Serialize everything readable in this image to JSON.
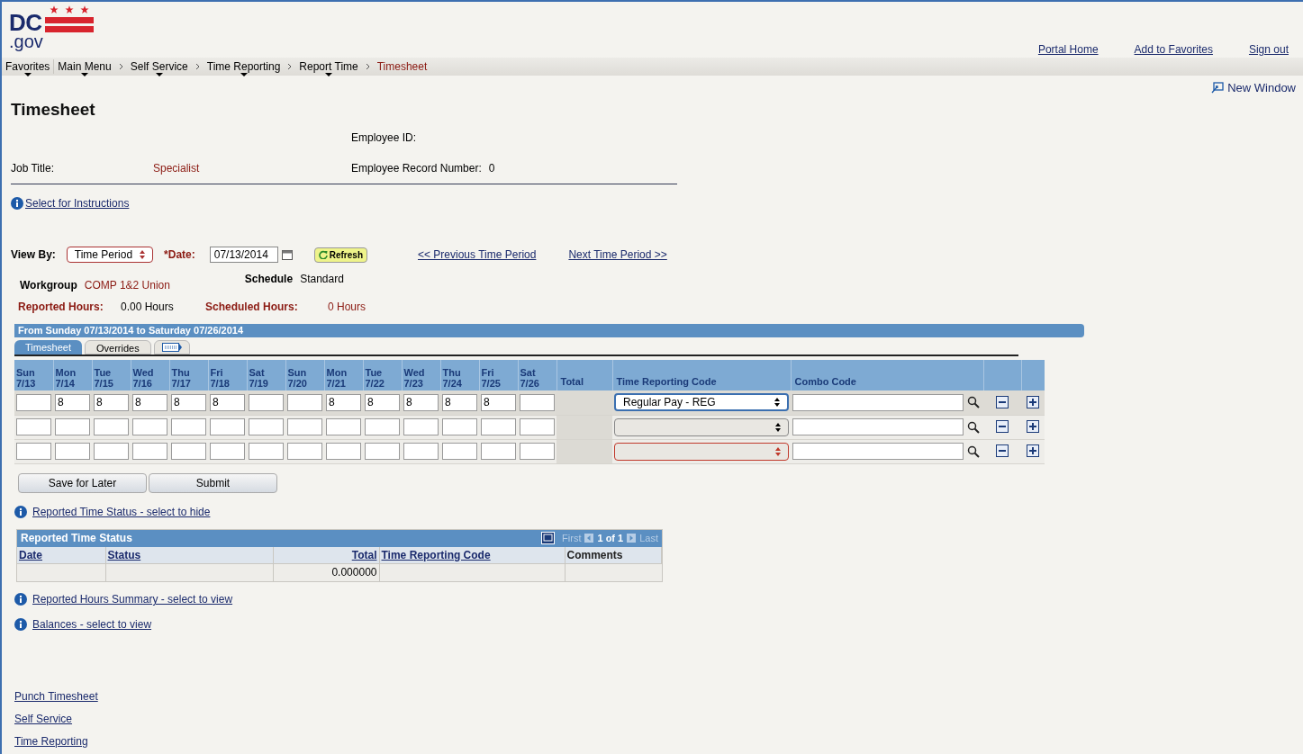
{
  "logo": {
    "name": "DC",
    "domain": ".gov"
  },
  "header_links": [
    "Portal Home",
    "Add to Favorites",
    "Sign out"
  ],
  "breadcrumb": [
    {
      "label": "Favorites",
      "dropdown": true,
      "current": false
    },
    {
      "label": "Main Menu",
      "dropdown": true,
      "current": false
    },
    {
      "label": "Self Service",
      "dropdown": true,
      "current": false
    },
    {
      "label": "Time Reporting",
      "dropdown": true,
      "current": false
    },
    {
      "label": "Report Time",
      "dropdown": true,
      "current": false
    },
    {
      "label": "Timesheet",
      "dropdown": false,
      "current": true
    }
  ],
  "new_window": "New Window",
  "title": "Timesheet",
  "employee_id": {
    "label": "Employee ID:"
  },
  "job_title": {
    "label": "Job Title:",
    "value": "Specialist"
  },
  "employee_record": {
    "label": "Employee Record Number:",
    "value": "0"
  },
  "instructions_link": "Select for Instructions",
  "view_by": {
    "label": "View By:",
    "value": "Time Period"
  },
  "date": {
    "label": "*Date:",
    "value": "07/13/2014"
  },
  "refresh": "Refresh",
  "previous_link": "<< Previous Time Period",
  "next_link": "Next Time Period >>",
  "workgroup": {
    "label": "Workgroup",
    "value": "COMP 1&2 Union"
  },
  "schedule": {
    "label": "Schedule",
    "value": "Standard"
  },
  "reported_hours": {
    "label": "Reported Hours:",
    "value": "0.00 Hours"
  },
  "scheduled_hours": {
    "label": "Scheduled Hours:",
    "value": "0 Hours"
  },
  "period_title": "From Sunday 07/13/2014 to Saturday 07/26/2014",
  "tabs": [
    {
      "label": "Timesheet",
      "selected": true
    },
    {
      "label": "Overrides",
      "selected": false
    }
  ],
  "grid": {
    "days": [
      {
        "day": "Sun",
        "date": "7/13"
      },
      {
        "day": "Mon",
        "date": "7/14"
      },
      {
        "day": "Tue",
        "date": "7/15"
      },
      {
        "day": "Wed",
        "date": "7/16"
      },
      {
        "day": "Thu",
        "date": "7/17"
      },
      {
        "day": "Fri",
        "date": "7/18"
      },
      {
        "day": "Sat",
        "date": "7/19"
      },
      {
        "day": "Sun",
        "date": "7/20"
      },
      {
        "day": "Mon",
        "date": "7/21"
      },
      {
        "day": "Tue",
        "date": "7/22"
      },
      {
        "day": "Wed",
        "date": "7/23"
      },
      {
        "day": "Thu",
        "date": "7/24"
      },
      {
        "day": "Fri",
        "date": "7/25"
      },
      {
        "day": "Sat",
        "date": "7/26"
      }
    ],
    "total_header": "Total",
    "trc_header": "Time Reporting Code",
    "combo_header": "Combo Code",
    "rows": [
      {
        "selected": true,
        "error": false,
        "hours": {
          "1": "8",
          "2": "8",
          "3": "8",
          "4": "8",
          "5": "8",
          "8": "8",
          "9": "8",
          "10": "8",
          "11": "8",
          "12": "8"
        },
        "trc": "Regular Pay - REG"
      },
      {
        "selected": false,
        "error": false
      },
      {
        "selected": false,
        "error": true
      }
    ]
  },
  "buttons": [
    "Save for Later",
    "Submit"
  ],
  "status_link": "Reported Time Status - select to hide",
  "status_table": {
    "title": "Reported Time Status",
    "first": "First",
    "count": "1 of 1",
    "last": "Last",
    "columns": [
      {
        "label": "Date",
        "link": true
      },
      {
        "label": "Status",
        "link": true
      },
      {
        "label": "Total",
        "link": true
      },
      {
        "label": "Time Reporting Code",
        "link": true
      },
      {
        "label": "Comments",
        "link": false
      }
    ],
    "rows": [
      {
        "total": "0.000000"
      }
    ]
  },
  "info_links": [
    "Reported Hours Summary - select to view",
    "Balances - select to view"
  ],
  "footer_links": [
    "Punch Timesheet",
    "Self Service",
    "Time Reporting"
  ]
}
